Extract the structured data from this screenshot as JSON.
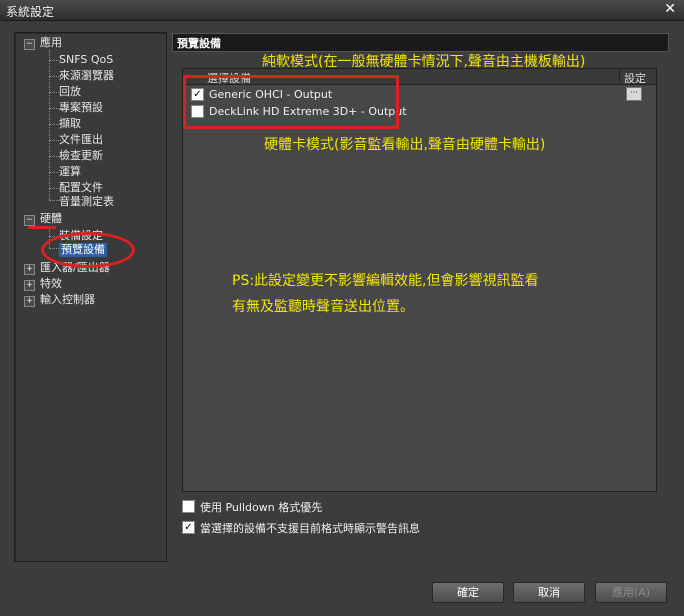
{
  "window": {
    "title": "系統設定",
    "close_glyph": "✕"
  },
  "tree": {
    "app": {
      "label": "應用",
      "expander": "−",
      "children": [
        "SNFS QoS",
        "來源瀏覽器",
        "回放",
        "專案預設",
        "擷取",
        "文件匯出",
        "檢查更新",
        "運算",
        "配置文件",
        "音量測定表"
      ]
    },
    "hardware": {
      "label": "硬體",
      "expander": "−",
      "children": [
        "裝備設定",
        "預覽設備"
      ],
      "selected": "預覽設備"
    },
    "others": [
      {
        "label": "匯入器/匯出器",
        "expander": "+"
      },
      {
        "label": "特效",
        "expander": "+"
      },
      {
        "label": "輸入控制器",
        "expander": "+"
      }
    ]
  },
  "panel": {
    "title": "預覽設備"
  },
  "device_list": {
    "columns": [
      "選擇設備",
      "設定"
    ],
    "rows": [
      {
        "label": "Generic OHCI - Output",
        "checked": true,
        "check_glyph": "✓",
        "settings_glyph": "···"
      },
      {
        "label": "DeckLink HD Extreme 3D+ - Output",
        "checked": false,
        "check_glyph": "",
        "settings_glyph": ""
      }
    ]
  },
  "annotations": {
    "software_mode": "純軟模式(在一般無硬體卡情況下,聲音由主機板輸出)",
    "hardware_mode": "硬體卡模式(影音監看輸出,聲音由硬體卡輸出)",
    "ps_line1": "PS:此設定變更不影響編輯效能,但會影響視訊監看",
    "ps_line2": "有無及監聽時聲音送出位置。",
    "color": "#f2e600",
    "frame_color": "#e0201e"
  },
  "options": [
    {
      "label": "使用 Pulldown 格式優先",
      "checked": false,
      "glyph": ""
    },
    {
      "label": "當選擇的設備不支援目前格式時顯示警告訊息",
      "checked": true,
      "glyph": "✓"
    }
  ],
  "buttons": {
    "ok": "確定",
    "cancel": "取消",
    "apply": "應用(A)"
  }
}
